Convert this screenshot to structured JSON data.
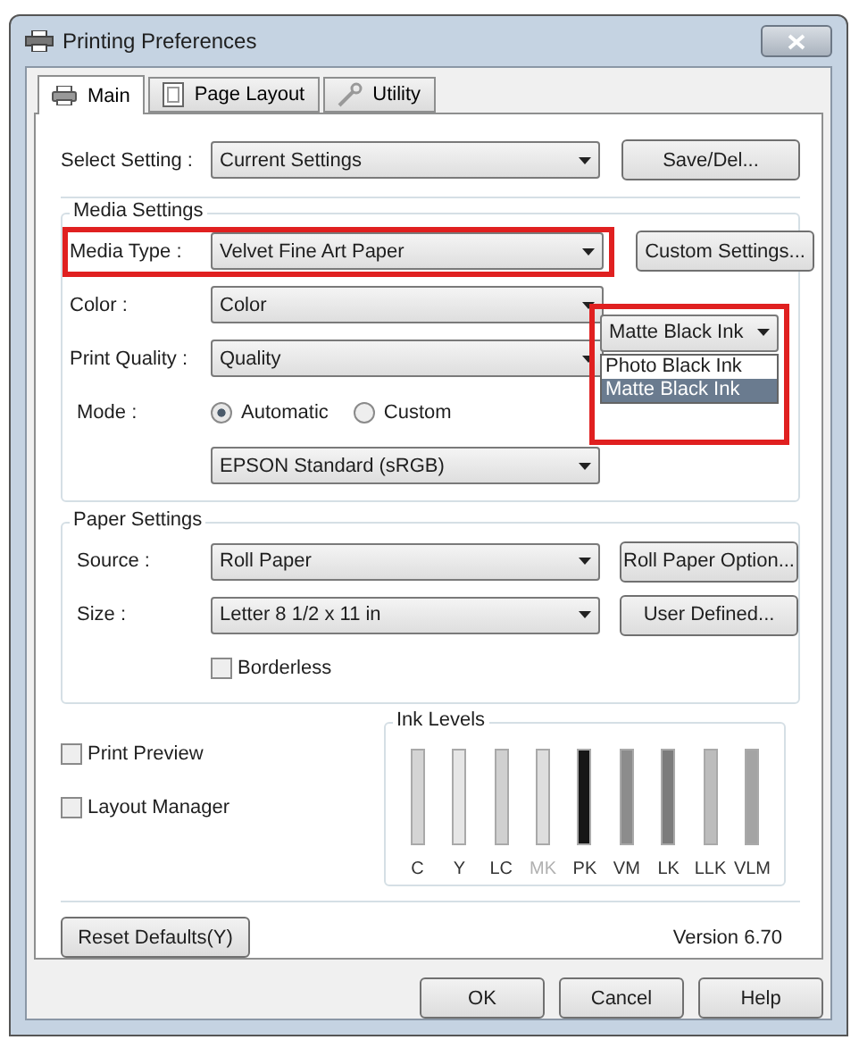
{
  "window": {
    "title": "Printing Preferences"
  },
  "tabs": [
    {
      "label": "Main",
      "selected": true,
      "kind": "printer"
    },
    {
      "label": "Page Layout",
      "selected": false,
      "kind": "page"
    },
    {
      "label": "Utility",
      "selected": false,
      "kind": "wrench"
    }
  ],
  "select_setting": {
    "label": "Select Setting :",
    "value": "Current Settings",
    "button": "Save/Del..."
  },
  "media_settings": {
    "title": "Media Settings",
    "rows": [
      {
        "label": "Media Type :",
        "value": "Velvet Fine Art Paper",
        "button": "Custom Settings...",
        "highlighted": true
      },
      {
        "label": "Color :",
        "value": "Color",
        "highlighted": false
      },
      {
        "label": "Print Quality :",
        "value": "Quality",
        "highlighted": false
      }
    ],
    "ink_select": {
      "value": "Matte Black Ink",
      "highlighted": true,
      "expanded": true,
      "options": [
        {
          "label": "Photo Black Ink",
          "selected": false
        },
        {
          "label": "Matte Black Ink",
          "selected": true
        }
      ]
    },
    "mode": {
      "label": "Mode :",
      "options": [
        {
          "label": "Automatic",
          "selected": true
        },
        {
          "label": "Custom",
          "selected": false
        }
      ],
      "value": "EPSON Standard (sRGB)"
    }
  },
  "paper_settings": {
    "title": "Paper Settings",
    "rows": [
      {
        "label": "Source :",
        "value": "Roll Paper",
        "button": "Roll Paper Option..."
      },
      {
        "label": "Size :",
        "value": "Letter 8 1/2 x 11 in",
        "button": "User Defined..."
      }
    ],
    "borderless": {
      "label": "Borderless",
      "checked": false
    }
  },
  "options": [
    {
      "label": "Print Preview",
      "checked": false
    },
    {
      "label": "Layout Manager",
      "checked": false
    }
  ],
  "ink_levels": {
    "title": "Ink Levels",
    "inks": [
      {
        "label": "C",
        "color": "#d4d4d4",
        "disabled": false
      },
      {
        "label": "Y",
        "color": "#e6e6e6",
        "disabled": false
      },
      {
        "label": "LC",
        "color": "#d0d0d0",
        "disabled": false
      },
      {
        "label": "MK",
        "color": "#dedede",
        "disabled": true
      },
      {
        "label": "PK",
        "color": "#161616",
        "disabled": false
      },
      {
        "label": "VM",
        "color": "#8c8c8c",
        "disabled": false
      },
      {
        "label": "LK",
        "color": "#7c7c7c",
        "disabled": false
      },
      {
        "label": "LLK",
        "color": "#bcbcbc",
        "disabled": false
      },
      {
        "label": "VLM",
        "color": "#a4a4a4",
        "disabled": false
      }
    ]
  },
  "reset_button": "Reset Defaults(Y)",
  "version": "Version 6.70",
  "buttons": [
    "OK",
    "Cancel",
    "Help"
  ]
}
